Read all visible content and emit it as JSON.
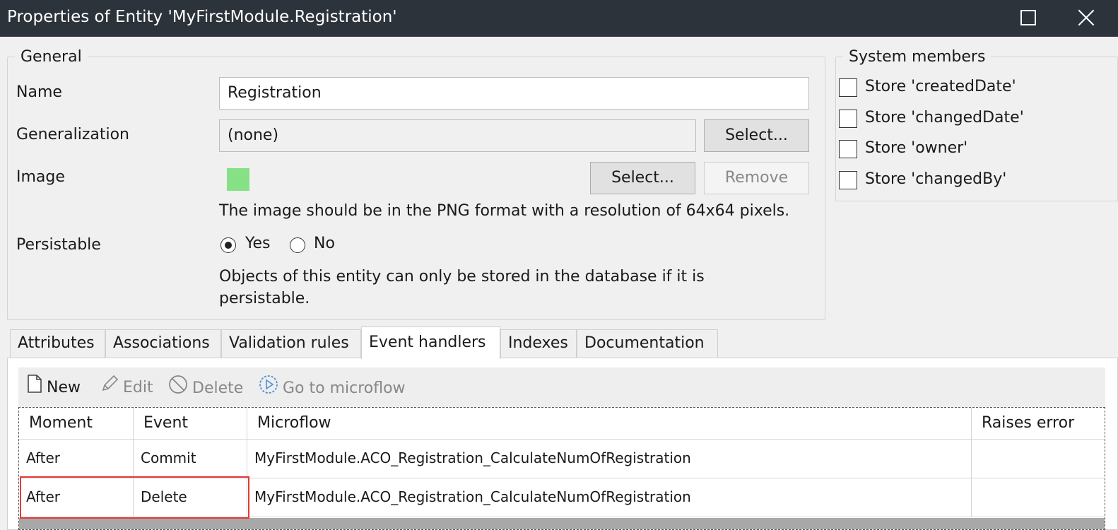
{
  "window": {
    "title": "Properties of Entity 'MyFirstModule.Registration'",
    "maximize_icon": "maximize-icon",
    "close_icon": "close-icon"
  },
  "general": {
    "legend": "General",
    "name_label": "Name",
    "name_value": "Registration",
    "generalization_label": "Generalization",
    "generalization_value": "(none)",
    "generalization_select": "Select...",
    "image_label": "Image",
    "image_select": "Select...",
    "image_remove": "Remove",
    "image_swatch_color": "#86e085",
    "image_note": "The image should be in the PNG format with a resolution of 64x64 pixels.",
    "persistable_label": "Persistable",
    "persistable_yes": "Yes",
    "persistable_no": "No",
    "persistable_selected": "Yes",
    "persistable_note_line1": "Objects of this entity can only be stored in the database if it is",
    "persistable_note_line2": "persistable."
  },
  "system_members": {
    "legend": "System members",
    "items": [
      {
        "label": "Store 'createdDate'",
        "checked": false
      },
      {
        "label": "Store 'changedDate'",
        "checked": false
      },
      {
        "label": "Store 'owner'",
        "checked": false
      },
      {
        "label": "Store 'changedBy'",
        "checked": false
      }
    ]
  },
  "tabs": [
    {
      "label": "Attributes",
      "active": false
    },
    {
      "label": "Associations",
      "active": false
    },
    {
      "label": "Validation rules",
      "active": false
    },
    {
      "label": "Event handlers",
      "active": true
    },
    {
      "label": "Indexes",
      "active": false
    },
    {
      "label": "Documentation",
      "active": false
    }
  ],
  "toolbar": {
    "new_label": "New",
    "edit_label": "Edit",
    "delete_label": "Delete",
    "goto_label": "Go to microflow"
  },
  "grid": {
    "columns": [
      "Moment",
      "Event",
      "Microflow",
      "Raises error"
    ],
    "rows": [
      {
        "moment": "After",
        "event": "Commit",
        "microflow": "MyFirstModule.ACO_Registration_CalculateNumOfRegistration",
        "raises_error": ""
      },
      {
        "moment": "After",
        "event": "Delete",
        "microflow": "MyFirstModule.ACO_Registration_CalculateNumOfRegistration",
        "raises_error": ""
      }
    ]
  },
  "colors": {
    "titlebar": "#2d333b",
    "highlight": "#e53935",
    "goto_icon": "#4a90d9"
  }
}
